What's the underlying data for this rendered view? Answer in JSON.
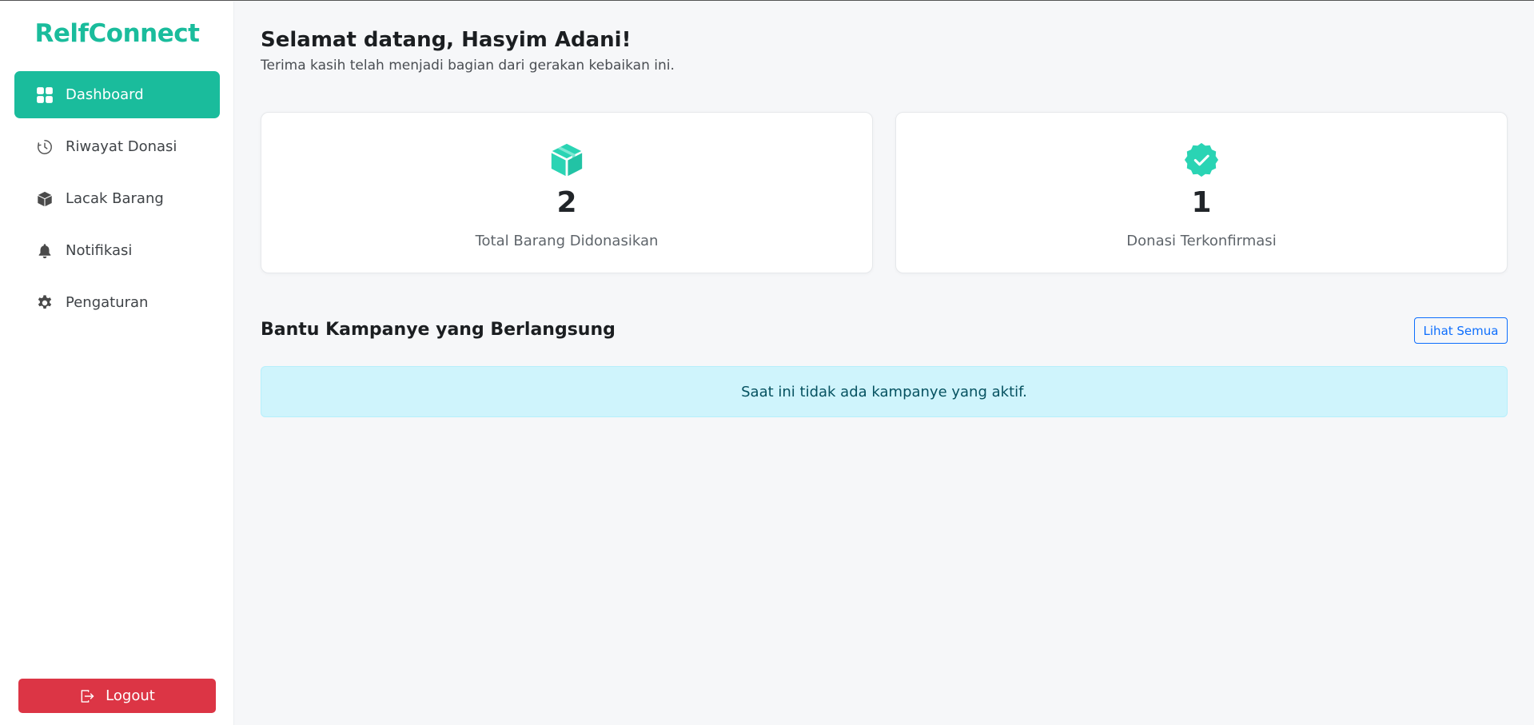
{
  "sidebar": {
    "brand": "RelfConnect",
    "items": [
      {
        "label": "Dashboard",
        "icon": "dashboard-grid-icon",
        "active": true
      },
      {
        "label": "Riwayat Donasi",
        "icon": "clock-history-icon"
      },
      {
        "label": "Lacak Barang",
        "icon": "box-icon"
      },
      {
        "label": "Notifikasi",
        "icon": "bell-icon"
      },
      {
        "label": "Pengaturan",
        "icon": "gear-icon"
      }
    ],
    "logout_label": "Logout"
  },
  "header": {
    "welcome": "Selamat datang, Hasyim Adani!",
    "subtitle": "Terima kasih telah menjadi bagian dari gerakan kebaikan ini."
  },
  "stats": [
    {
      "value": "2",
      "label": "Total Barang Didonasikan",
      "icon": "box-icon"
    },
    {
      "value": "1",
      "label": "Donasi Terkonfirmasi",
      "icon": "verified-badge-icon"
    }
  ],
  "campaigns": {
    "title": "Bantu Kampanye yang Berlangsung",
    "see_all_label": "Lihat Semua",
    "empty_message": "Saat ini tidak ada kampanye yang aktif."
  },
  "colors": {
    "brand": "#1abc9c",
    "logout": "#dc3545",
    "link": "#0d6efd",
    "info_bg": "#cff4fc",
    "icon_teal": "#2ad4b4"
  }
}
